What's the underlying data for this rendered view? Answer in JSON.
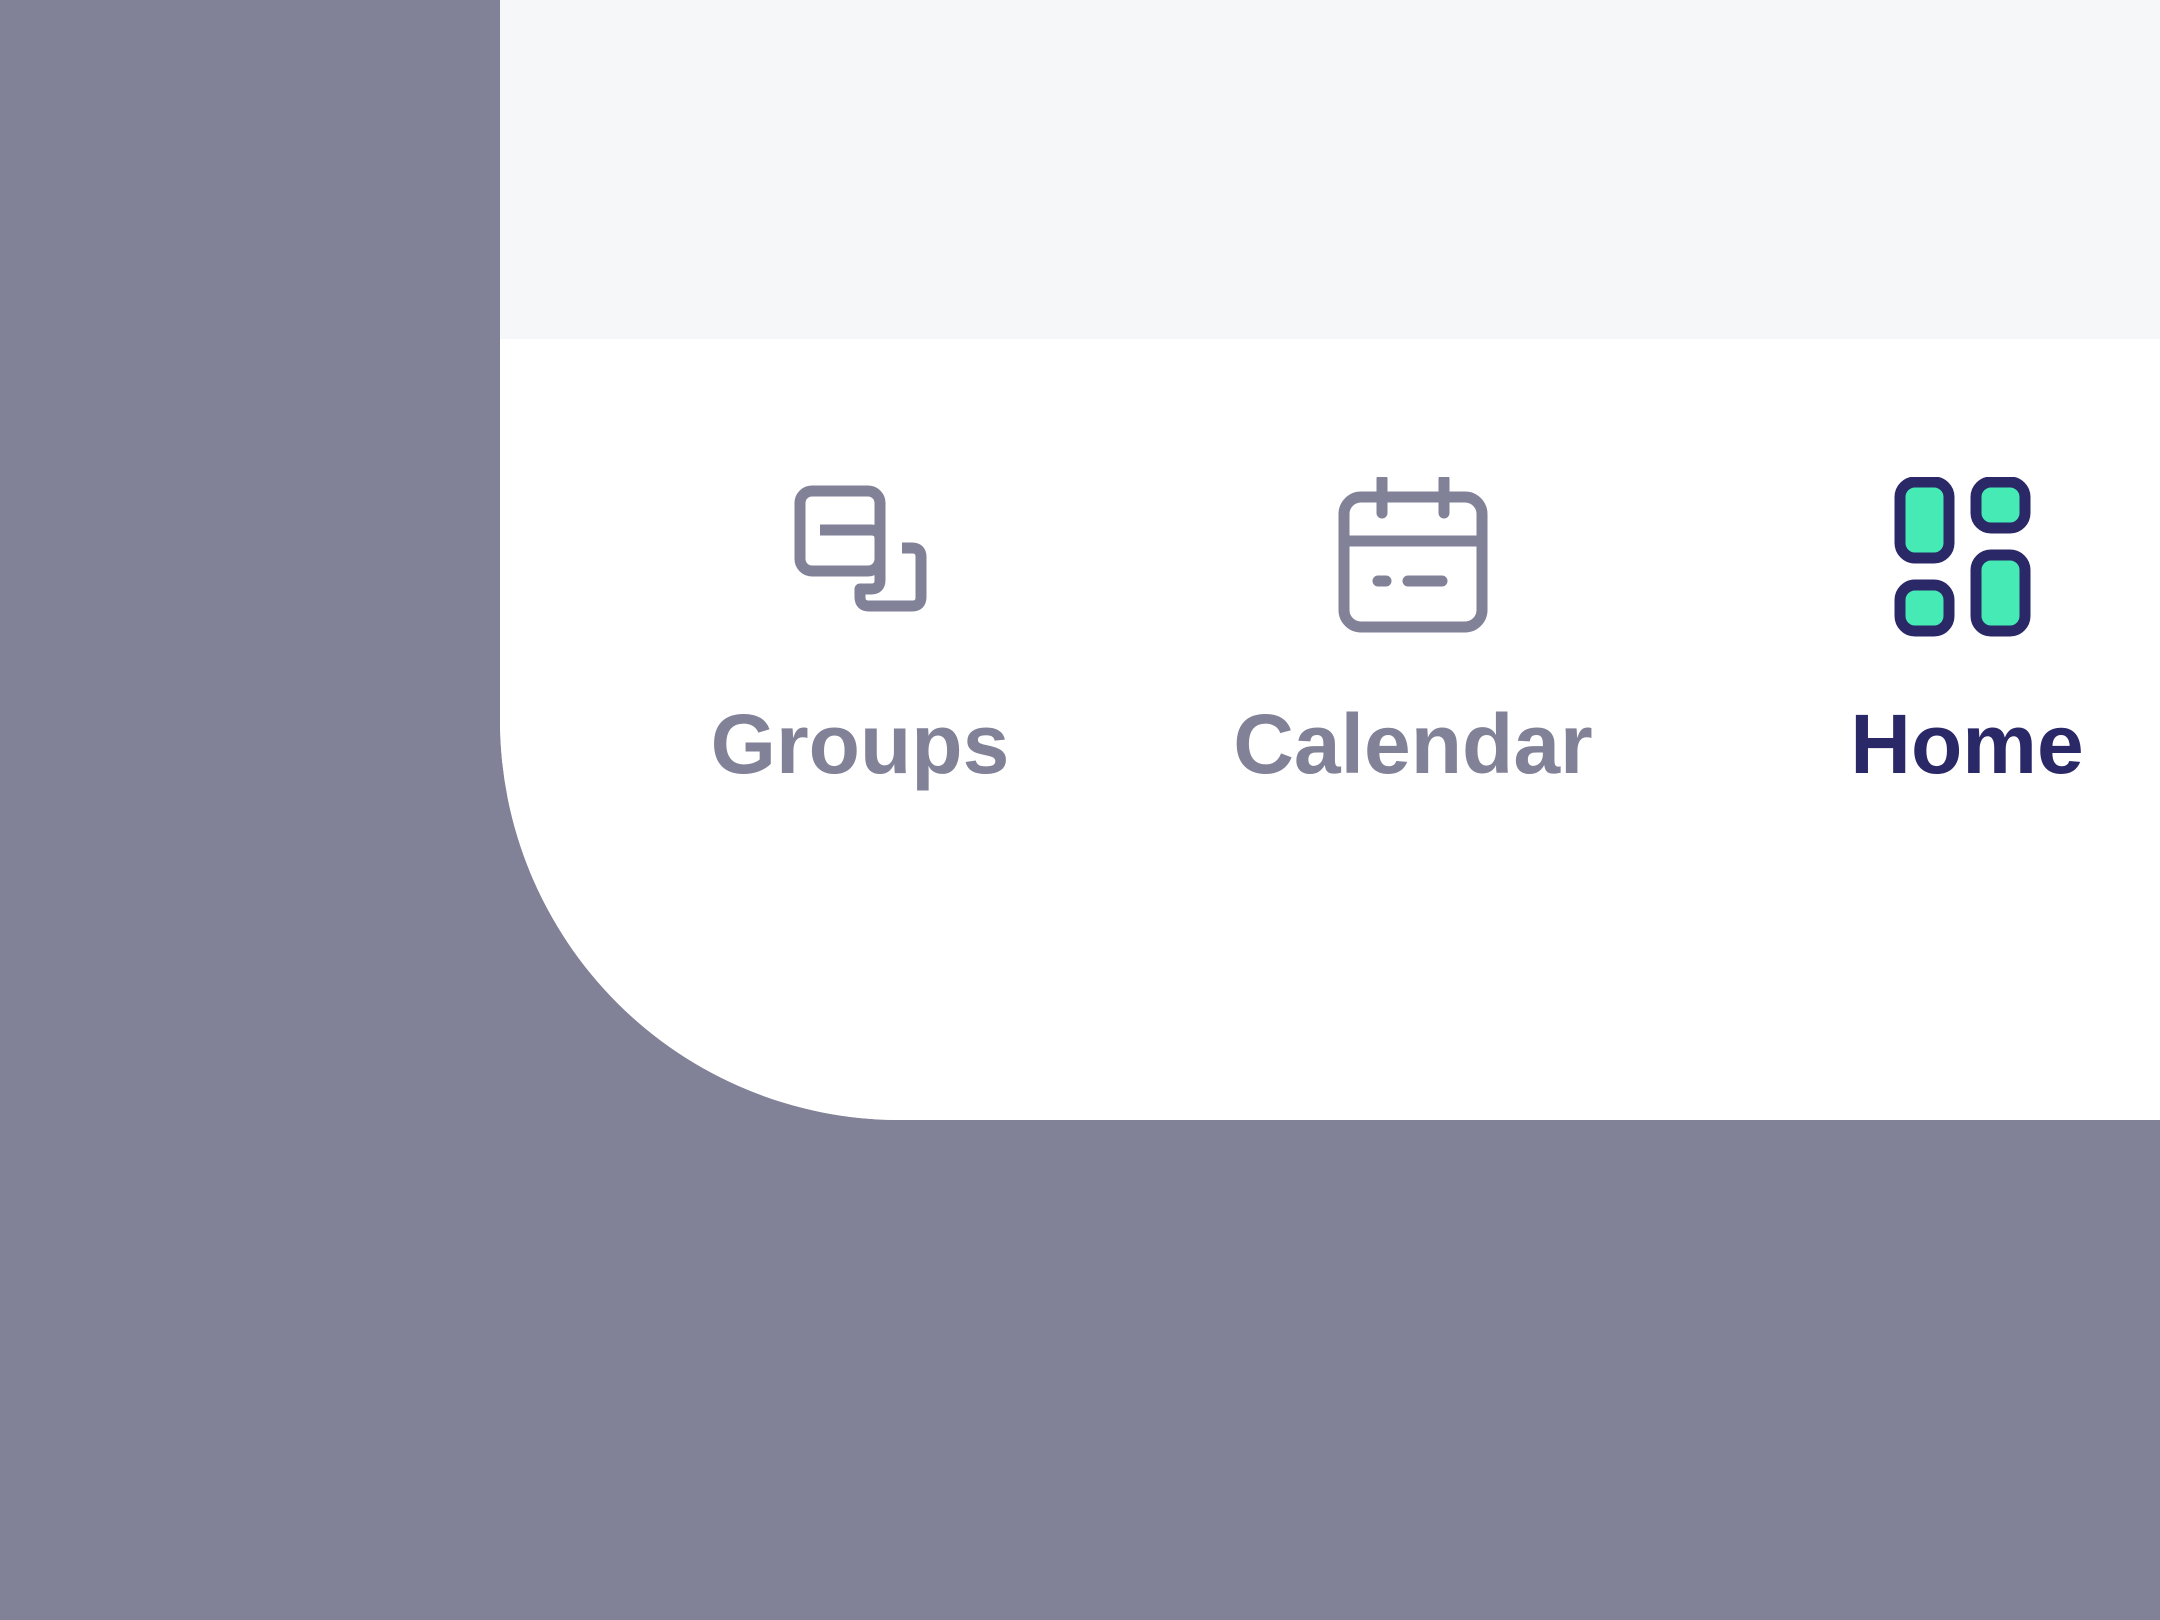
{
  "colors": {
    "backdrop": "#818198",
    "surface": "#ffffff",
    "content_background": "#f6f7f9",
    "inactive": "#818198",
    "active": "#2b2868",
    "accent": "#46eab5"
  },
  "tab_bar": {
    "tabs": [
      {
        "label": "Groups",
        "icon": "overlapping-squares-icon",
        "active": false
      },
      {
        "label": "Calendar",
        "icon": "calendar-icon",
        "active": false
      },
      {
        "label": "Home",
        "icon": "dashboard-grid-icon",
        "active": true
      }
    ]
  }
}
